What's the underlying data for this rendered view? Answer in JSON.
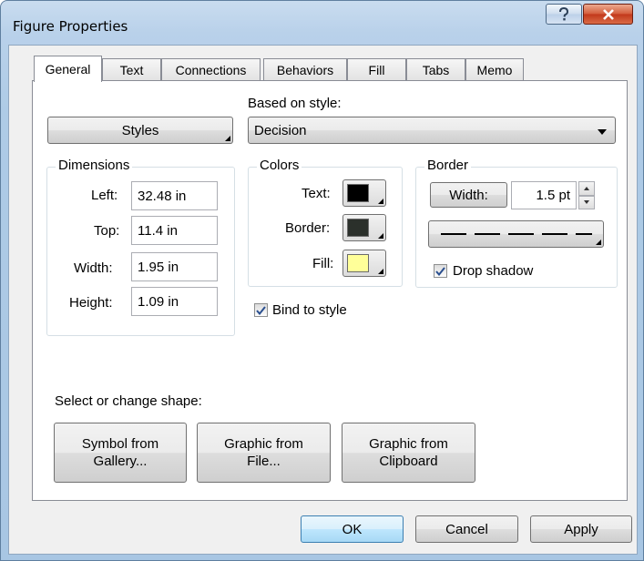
{
  "window": {
    "title": "Figure Properties"
  },
  "tabs": [
    {
      "label": "General",
      "active": true
    },
    {
      "label": "Text"
    },
    {
      "label": "Connections"
    },
    {
      "label": "Behaviors"
    },
    {
      "label": "Fill"
    },
    {
      "label": "Tabs"
    },
    {
      "label": "Memo"
    }
  ],
  "general": {
    "styles_button": "Styles",
    "based_on_style_label": "Based on style:",
    "based_on_style_value": "Decision",
    "dimensions": {
      "title": "Dimensions",
      "left_label": "Left:",
      "left_value": "32.48 in",
      "top_label": "Top:",
      "top_value": "11.4 in",
      "width_label": "Width:",
      "width_value": "1.95 in",
      "height_label": "Height:",
      "height_value": "1.09 in"
    },
    "colors": {
      "title": "Colors",
      "text_label": "Text:",
      "text_color": "#000000",
      "border_label": "Border:",
      "border_color": "#2b302b",
      "fill_label": "Fill:",
      "fill_color": "#ffff99"
    },
    "border": {
      "title": "Border",
      "width_button": "Width:",
      "width_value": "1.5 pt",
      "line_style": "dashed",
      "drop_shadow_label": "Drop shadow",
      "drop_shadow_checked": true
    },
    "bind_to_style_label": "Bind to style",
    "bind_to_style_checked": true,
    "shape": {
      "label": "Select or change shape:",
      "symbol_from_gallery": "Symbol from Gallery...",
      "graphic_from_file": "Graphic from File...",
      "graphic_from_clipboard": "Graphic from Clipboard"
    }
  },
  "footer": {
    "ok": "OK",
    "cancel": "Cancel",
    "apply": "Apply"
  }
}
